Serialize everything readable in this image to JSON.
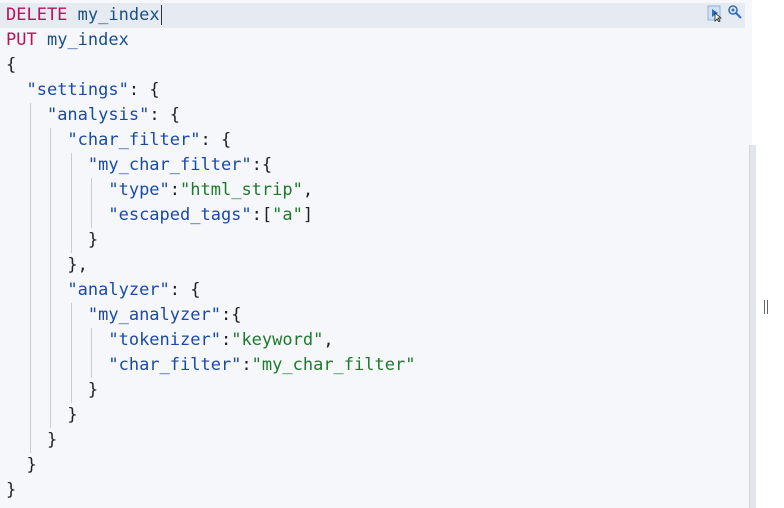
{
  "editor": {
    "lines": [
      {
        "parts": [
          {
            "c": "kw",
            "t": "DELETE"
          },
          {
            "c": "pun",
            "t": " "
          },
          {
            "c": "path",
            "t": "my_index"
          }
        ],
        "cursor": true
      },
      {
        "parts": [
          {
            "c": "kw",
            "t": "PUT"
          },
          {
            "c": "pun",
            "t": " "
          },
          {
            "c": "path",
            "t": "my_index"
          }
        ]
      },
      {
        "parts": [
          {
            "c": "pun",
            "t": "{"
          }
        ]
      },
      {
        "parts": [
          {
            "c": "pun",
            "t": "  "
          },
          {
            "c": "key",
            "t": "\"settings\""
          },
          {
            "c": "pun",
            "t": ": {"
          }
        ]
      },
      {
        "parts": [
          {
            "c": "pun",
            "t": "    "
          },
          {
            "c": "key",
            "t": "\"analysis\""
          },
          {
            "c": "pun",
            "t": ": {"
          }
        ]
      },
      {
        "parts": [
          {
            "c": "pun",
            "t": "      "
          },
          {
            "c": "key",
            "t": "\"char_filter\""
          },
          {
            "c": "pun",
            "t": ": {"
          }
        ]
      },
      {
        "parts": [
          {
            "c": "pun",
            "t": "        "
          },
          {
            "c": "key",
            "t": "\"my_char_filter\""
          },
          {
            "c": "pun",
            "t": ":{"
          }
        ]
      },
      {
        "parts": [
          {
            "c": "pun",
            "t": "          "
          },
          {
            "c": "key",
            "t": "\"type\""
          },
          {
            "c": "pun",
            "t": ":"
          },
          {
            "c": "str",
            "t": "\"html_strip\""
          },
          {
            "c": "pun",
            "t": ","
          }
        ]
      },
      {
        "parts": [
          {
            "c": "pun",
            "t": "          "
          },
          {
            "c": "key",
            "t": "\"escaped_tags\""
          },
          {
            "c": "pun",
            "t": ":["
          },
          {
            "c": "str",
            "t": "\"a\""
          },
          {
            "c": "pun",
            "t": "]"
          }
        ]
      },
      {
        "parts": [
          {
            "c": "pun",
            "t": "        }"
          }
        ]
      },
      {
        "parts": [
          {
            "c": "pun",
            "t": "      },"
          }
        ]
      },
      {
        "parts": [
          {
            "c": "pun",
            "t": "      "
          },
          {
            "c": "key",
            "t": "\"analyzer\""
          },
          {
            "c": "pun",
            "t": ": {"
          }
        ]
      },
      {
        "parts": [
          {
            "c": "pun",
            "t": "        "
          },
          {
            "c": "key",
            "t": "\"my_analyzer\""
          },
          {
            "c": "pun",
            "t": ":{"
          }
        ]
      },
      {
        "parts": [
          {
            "c": "pun",
            "t": "          "
          },
          {
            "c": "key",
            "t": "\"tokenizer\""
          },
          {
            "c": "pun",
            "t": ":"
          },
          {
            "c": "str",
            "t": "\"keyword\""
          },
          {
            "c": "pun",
            "t": ","
          }
        ]
      },
      {
        "parts": [
          {
            "c": "pun",
            "t": "          "
          },
          {
            "c": "key",
            "t": "\"char_filter\""
          },
          {
            "c": "pun",
            "t": ":"
          },
          {
            "c": "str",
            "t": "\"my_char_filter\""
          }
        ]
      },
      {
        "parts": [
          {
            "c": "pun",
            "t": "        }"
          }
        ]
      },
      {
        "parts": [
          {
            "c": "pun",
            "t": "      }"
          }
        ]
      },
      {
        "parts": [
          {
            "c": "pun",
            "t": "    }"
          }
        ]
      },
      {
        "parts": [
          {
            "c": "pun",
            "t": "  }"
          }
        ]
      },
      {
        "parts": [
          {
            "c": "pun",
            "t": "}"
          }
        ]
      }
    ]
  },
  "actions": {
    "run_icon": "play-request-icon",
    "settings_icon": "wrench-icon"
  },
  "colors": {
    "method": "#b8125a",
    "key": "#1a4aa8",
    "string": "#1d7a2b",
    "active_line": "#e6ebf2"
  }
}
